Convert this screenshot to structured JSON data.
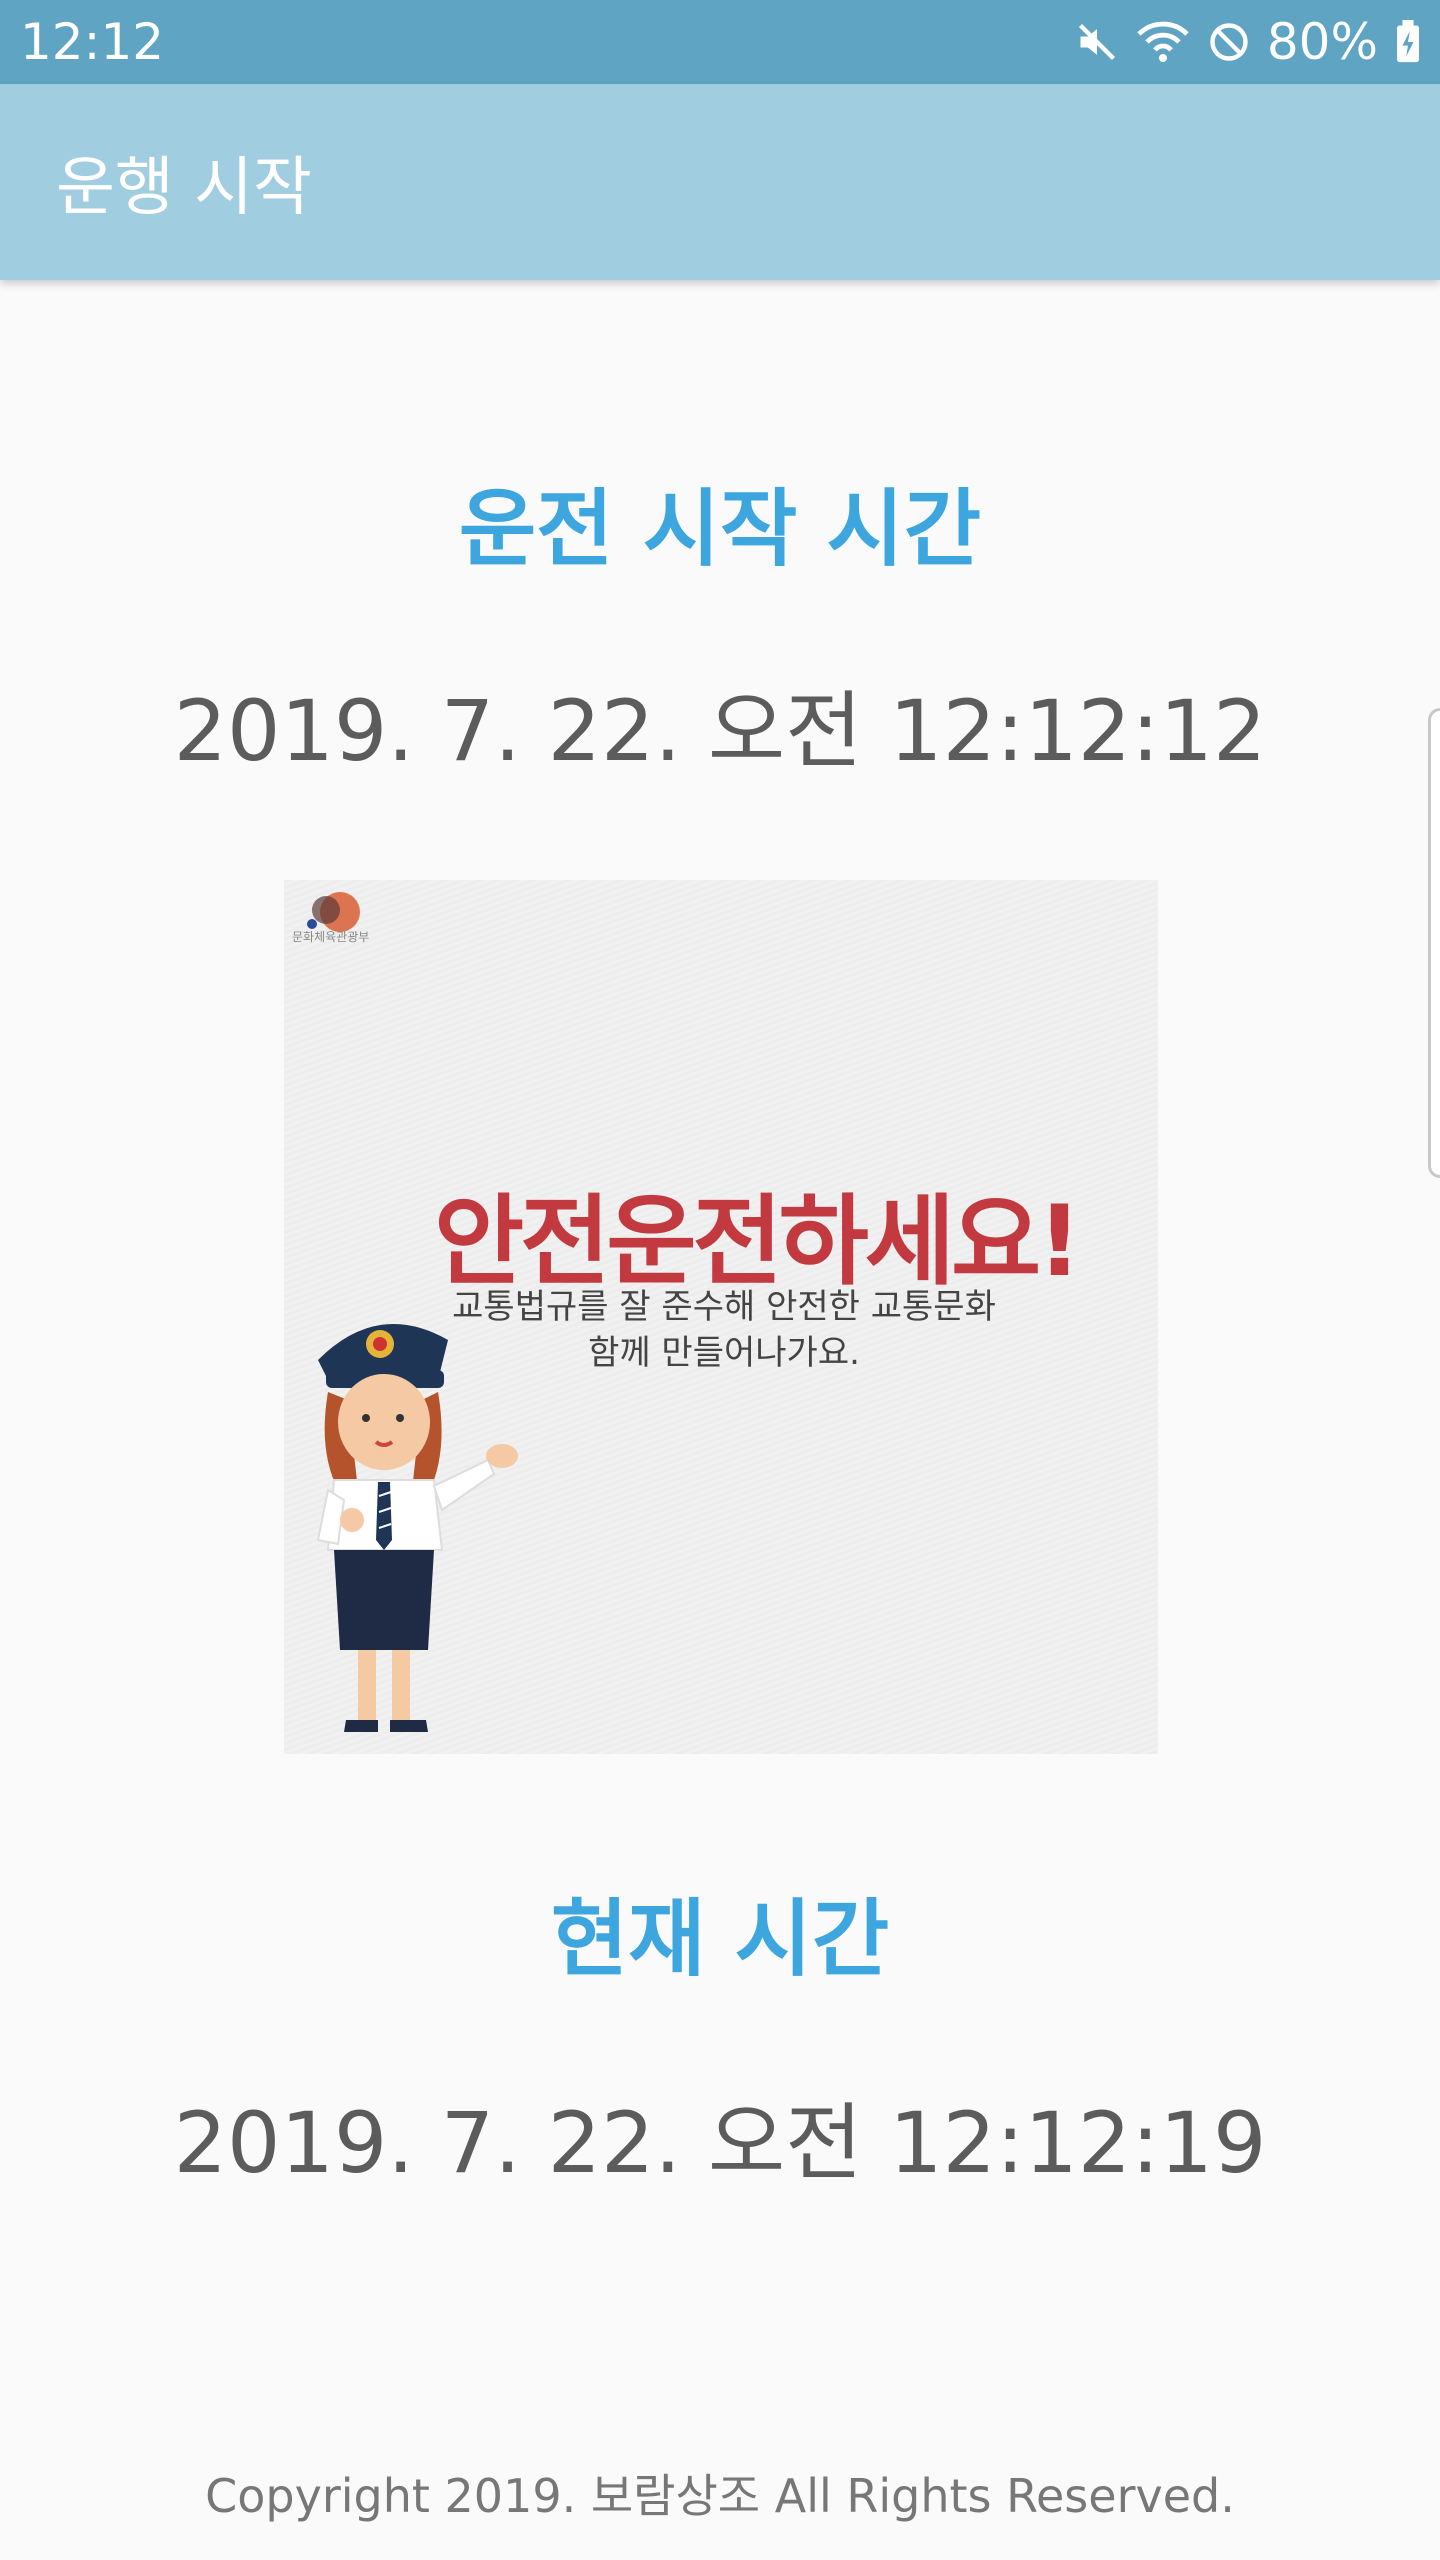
{
  "status_bar": {
    "time": "12:12",
    "battery_percent": "80%",
    "icons": [
      "mute-icon",
      "wifi-icon",
      "do-not-disturb-icon",
      "battery-charging-icon"
    ]
  },
  "app_bar": {
    "title": "운행 시작"
  },
  "start_section": {
    "title": "운전 시작 시간",
    "value": "2019. 7. 22. 오전 12:12:12"
  },
  "banner": {
    "logo_text": "문화체육관광부",
    "headline": "안전운전하세요!",
    "subtitle_line1": "교통법규를 잘 준수해 안전한 교통문화",
    "subtitle_line2": "함께 만들어나가요."
  },
  "current_section": {
    "title": "현재 시간",
    "value": "2019. 7. 22. 오전 12:12:19"
  },
  "footer": {
    "copyright": "Copyright 2019. 보람상조 All Rights Reserved."
  },
  "colors": {
    "status_bar": "#5fa4c2",
    "app_bar": "#a1cde0",
    "section_title": "#3ea6de",
    "time_text": "#5c5c5c",
    "banner_headline": "#c23a3f"
  }
}
